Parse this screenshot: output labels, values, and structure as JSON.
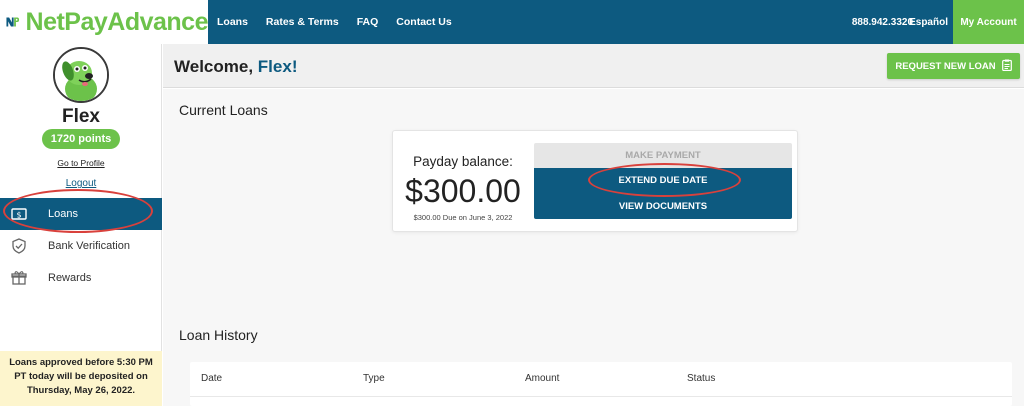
{
  "header": {
    "logo": "NetPayAdvance",
    "nav": [
      "Loans",
      "Rates & Terms",
      "FAQ",
      "Contact Us"
    ],
    "phone": "888.942.3320",
    "language_link": "Español",
    "account_button": "My Account"
  },
  "sidebar": {
    "username": "Flex",
    "points": "1720 points",
    "profile_link": "Go to Profile",
    "logout_link": "Logout",
    "items": [
      {
        "label": "Loans",
        "icon": "dollar-bill-icon",
        "active": true
      },
      {
        "label": "Bank Verification",
        "icon": "shield-check-icon",
        "active": false
      },
      {
        "label": "Rewards",
        "icon": "gift-box-icon",
        "active": false
      }
    ],
    "notice": "Loans approved before 5:30 PM PT today will be deposited on Thursday, May 26, 2022."
  },
  "welcome": {
    "greeting": "Welcome,",
    "name": "Flex!",
    "request_button": "REQUEST NEW LOAN"
  },
  "current_loans": {
    "title": "Current Loans",
    "balance_label": "Payday balance:",
    "balance_amount": "$300.00",
    "due_text": "$300.00 Due on June 3, 2022",
    "buttons": {
      "make_payment": "MAKE PAYMENT",
      "extend_due_date": "EXTEND DUE DATE",
      "view_documents": "VIEW DOCUMENTS"
    }
  },
  "loan_history": {
    "title": "Loan History",
    "columns": [
      "Date",
      "Type",
      "Amount",
      "Status"
    ]
  },
  "colors": {
    "brand_blue": "#0d5a80",
    "brand_green": "#6cc24a",
    "annotation_red": "#d9413c",
    "notice_bg": "#fdf5cd"
  }
}
